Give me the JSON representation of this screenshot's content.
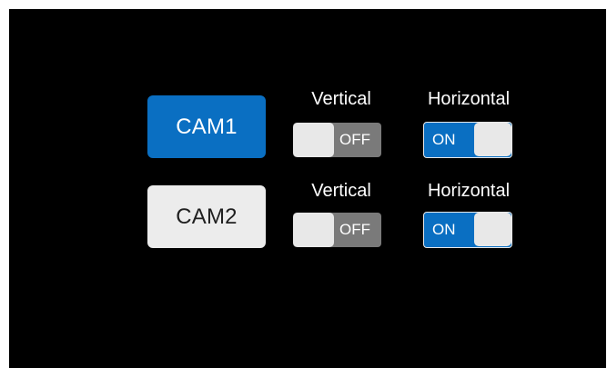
{
  "colors": {
    "accent": "#0a6fc2",
    "off_track": "#7a7a7a",
    "knob": "#e8e8e8",
    "background": "#000000"
  },
  "cams": [
    {
      "label": "CAM1",
      "selected": true,
      "vertical_label": "Vertical",
      "horizontal_label": "Horizontal",
      "vertical_state": "OFF",
      "horizontal_state": "ON"
    },
    {
      "label": "CAM2",
      "selected": false,
      "vertical_label": "Vertical",
      "horizontal_label": "Horizontal",
      "vertical_state": "OFF",
      "horizontal_state": "ON"
    }
  ]
}
